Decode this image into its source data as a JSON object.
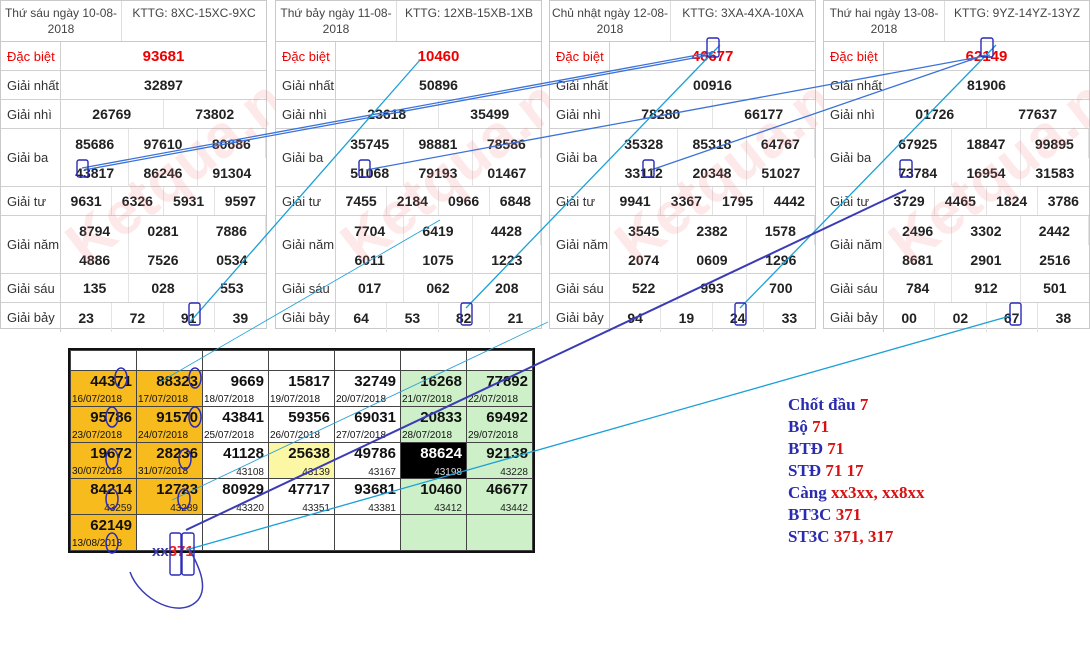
{
  "watermark": "Ketqua.net",
  "labels": [
    "Đặc biệt",
    "Giải nhất",
    "Giải nhì",
    "Giải ba",
    "Giải tư",
    "Giải năm",
    "Giải sáu",
    "Giải bảy"
  ],
  "results": [
    {
      "date": "Thứ sáu ngày 10-08-2018",
      "code": "KTTG: 8XC-15XC-9XC",
      "db": [
        "93681"
      ],
      "g1": [
        "32897"
      ],
      "g2": [
        "26769",
        "73802"
      ],
      "g3": [
        "85686",
        "97610",
        "80686",
        "43817",
        "86246",
        "91304"
      ],
      "g4": [
        "9631",
        "6326",
        "5931",
        "9597"
      ],
      "g5": [
        "8794",
        "0281",
        "7886",
        "4886",
        "7526",
        "0534"
      ],
      "g6": [
        "135",
        "028",
        "553"
      ],
      "g7": [
        "23",
        "72",
        "91",
        "39"
      ]
    },
    {
      "date": "Thứ bảy ngày 11-08-2018",
      "code": "KTTG: 12XB-15XB-1XB",
      "db": [
        "10460"
      ],
      "g1": [
        "50896"
      ],
      "g2": [
        "23618",
        "35499"
      ],
      "g3": [
        "35745",
        "98881",
        "78586",
        "51068",
        "79193",
        "01467"
      ],
      "g4": [
        "7455",
        "2184",
        "0966",
        "6848"
      ],
      "g5": [
        "7704",
        "6419",
        "4428",
        "6011",
        "1075",
        "1223"
      ],
      "g6": [
        "017",
        "062",
        "208"
      ],
      "g7": [
        "64",
        "53",
        "82",
        "21"
      ]
    },
    {
      "date": "Chủ nhật ngày 12-08-2018",
      "code": "KTTG: 3XA-4XA-10XA",
      "db": [
        "46677"
      ],
      "g1": [
        "00916"
      ],
      "g2": [
        "78280",
        "66177"
      ],
      "g3": [
        "35328",
        "85318",
        "64767",
        "33112",
        "20348",
        "51027"
      ],
      "g4": [
        "9941",
        "3367",
        "1795",
        "4442"
      ],
      "g5": [
        "3545",
        "2382",
        "1578",
        "2074",
        "0609",
        "1296"
      ],
      "g6": [
        "522",
        "993",
        "700"
      ],
      "g7": [
        "94",
        "19",
        "24",
        "33"
      ]
    },
    {
      "date": "Thứ hai ngày 13-08-2018",
      "code": "KTTG: 9YZ-14YZ-13YZ",
      "db": [
        "62149"
      ],
      "g1": [
        "81906"
      ],
      "g2": [
        "01726",
        "77637"
      ],
      "g3": [
        "67925",
        "18847",
        "99895",
        "73784",
        "16954",
        "31583"
      ],
      "g4": [
        "3729",
        "4465",
        "1824",
        "3786"
      ],
      "g5": [
        "2496",
        "3302",
        "2442",
        "8681",
        "2901",
        "2516"
      ],
      "g6": [
        "784",
        "912",
        "501"
      ],
      "g7": [
        "00",
        "02",
        "67",
        "38"
      ]
    }
  ],
  "grid": [
    [
      {
        "n": "44371",
        "d": "16/07/2018"
      },
      {
        "n": "88323",
        "d": "17/07/2018"
      },
      {
        "n": "9669",
        "d": "18/07/2018"
      },
      {
        "n": "15817",
        "d": "19/07/2018"
      },
      {
        "n": "32749",
        "d": "20/07/2018"
      },
      {
        "n": "16268",
        "d": "21/07/2018"
      },
      {
        "n": "77892",
        "d": "22/07/2018"
      }
    ],
    [
      {
        "n": "95786",
        "d": "23/07/2018"
      },
      {
        "n": "91570",
        "d": "24/07/2018"
      },
      {
        "n": "43841",
        "d": "25/07/2018"
      },
      {
        "n": "59356",
        "d": "26/07/2018"
      },
      {
        "n": "69031",
        "d": "27/07/2018"
      },
      {
        "n": "20833",
        "d": "28/07/2018"
      },
      {
        "n": "69492",
        "d": "29/07/2018"
      }
    ],
    [
      {
        "n": "19672",
        "d": "30/07/2018"
      },
      {
        "n": "28236",
        "d": "31/07/2018"
      },
      {
        "n": "41128",
        "c": "43108"
      },
      {
        "n": "25638",
        "c": "43139"
      },
      {
        "n": "49786",
        "c": "43167"
      },
      {
        "n": "88624",
        "c": "43198"
      },
      {
        "n": "92138",
        "c": "43228"
      }
    ],
    [
      {
        "n": "84214",
        "c": "43259"
      },
      {
        "n": "12723",
        "c": "43289"
      },
      {
        "n": "80929",
        "c": "43320"
      },
      {
        "n": "47717",
        "c": "43351"
      },
      {
        "n": "93681",
        "c": "43381"
      },
      {
        "n": "10460",
        "c": "43412"
      },
      {
        "n": "46677",
        "c": "43442"
      }
    ],
    [
      {
        "n": "62149",
        "d": "13/08/2018"
      },
      {
        "n": "",
        "d": ""
      },
      {
        "n": "",
        "d": ""
      },
      {
        "n": "",
        "d": ""
      },
      {
        "n": "",
        "d": ""
      },
      {
        "n": "",
        "d": ""
      },
      {
        "n": "",
        "d": ""
      }
    ]
  ],
  "grid_note": {
    "prefix": "xx",
    "value": "371"
  },
  "summary": [
    {
      "k": "Chốt  đầu ",
      "v": "7"
    },
    {
      "k": "Bộ ",
      "v": "71"
    },
    {
      "k": "BTĐ ",
      "v": "71"
    },
    {
      "k": "STĐ ",
      "v": "71 17"
    },
    {
      "k": "Càng ",
      "v": "xx3xx, xx8xx"
    },
    {
      "k": "BT3C ",
      "v": "371"
    },
    {
      "k": "ST3C ",
      "v": "371, 317"
    }
  ],
  "colors": {
    "accent_red": "#e00000",
    "line_blue": "#3b3bb5",
    "line_cyan": "#1aa0d8",
    "orange": "#f7bb1e",
    "green": "#cdf0c8"
  }
}
